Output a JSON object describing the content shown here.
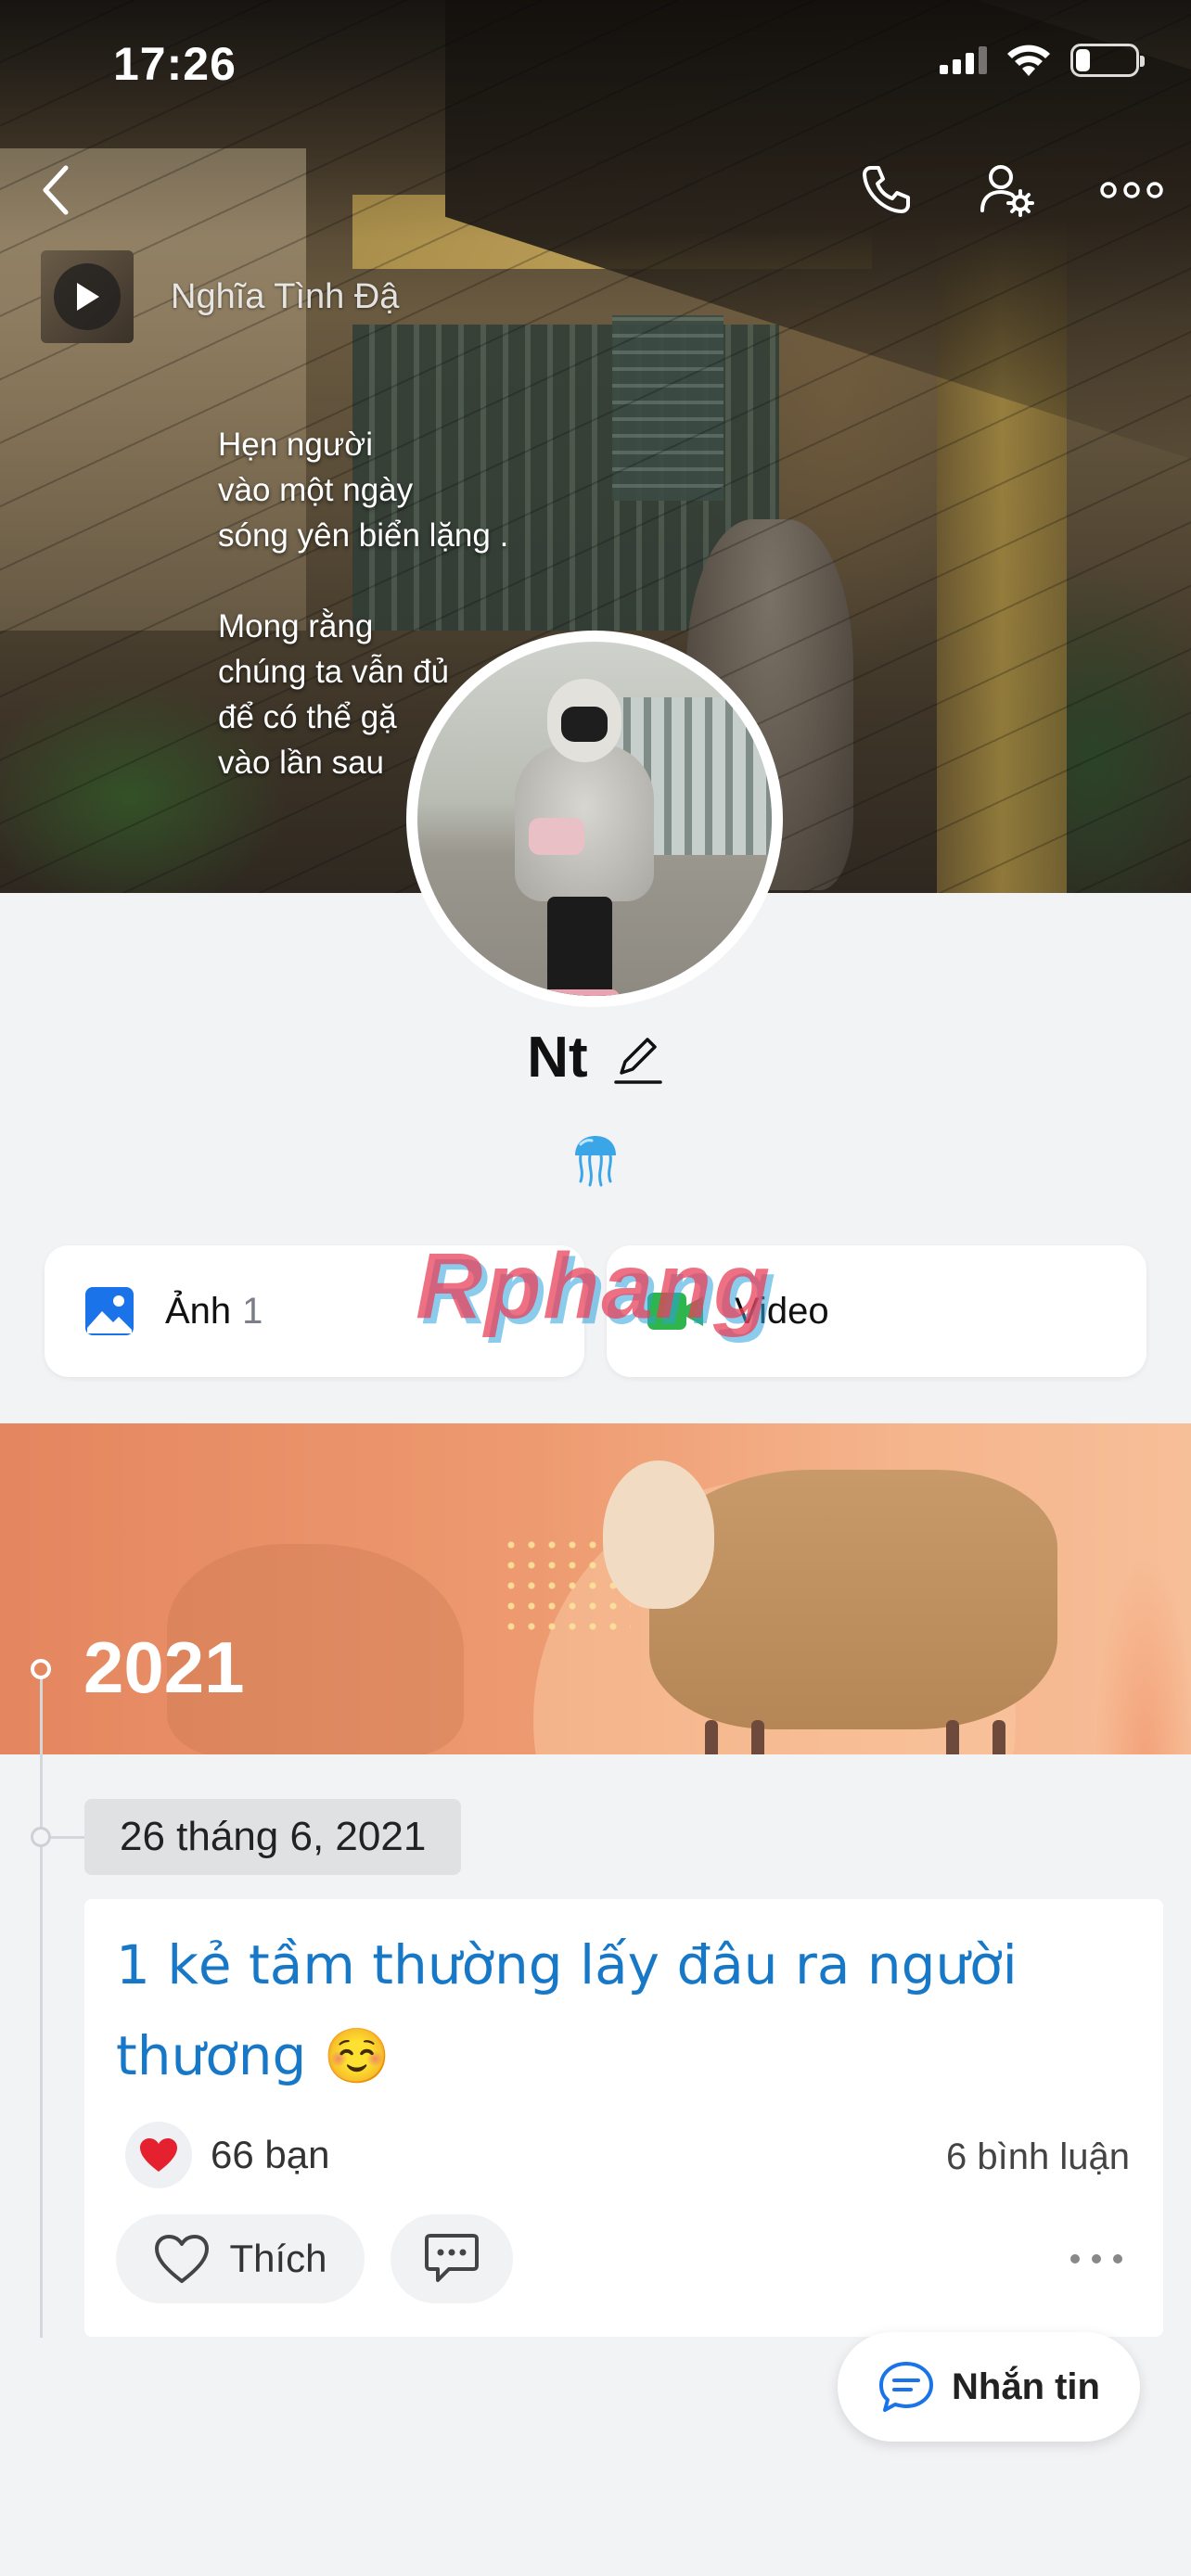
{
  "status_bar": {
    "time": "17:26"
  },
  "cover": {
    "music_title": "Nghĩa Tình Đậ",
    "text_lines": [
      "Hẹn người",
      "vào một ngày",
      "sóng yên biển lặng .",
      "",
      "Mong rằng",
      "chúng ta vẫn đủ",
      "để có thể gặ",
      "vào lần sau"
    ]
  },
  "profile": {
    "name": "Nt",
    "status_emoji": "jellyfish"
  },
  "media": {
    "photos_label": "Ảnh",
    "photos_count": "1",
    "videos_label": "Video"
  },
  "watermark": "Rphang",
  "timeline": {
    "year": "2021",
    "date": "26 tháng 6, 2021",
    "post": {
      "text": "1 kẻ tầm thường lấy đâu ra người thương ☺️",
      "reaction_count": "66 bạn",
      "comment_count": "6 bình luận",
      "like_label": "Thích"
    }
  },
  "message_button": {
    "label": "Nhắn tin"
  },
  "colors": {
    "accent_blue": "#1878c8",
    "heart_red": "#e5212f",
    "video_green": "#2fb54d",
    "photo_blue": "#1a73e8",
    "banner_orange": "#ee9a70"
  },
  "icons": {
    "back": "chevron-left-icon",
    "call": "phone-icon",
    "settings": "user-gear-icon",
    "more": "more-horizontal-icon",
    "photos": "image-icon",
    "videos": "video-camera-icon",
    "like": "heart-outline-icon",
    "comment": "chat-bubble-icon",
    "message": "message-icon"
  }
}
